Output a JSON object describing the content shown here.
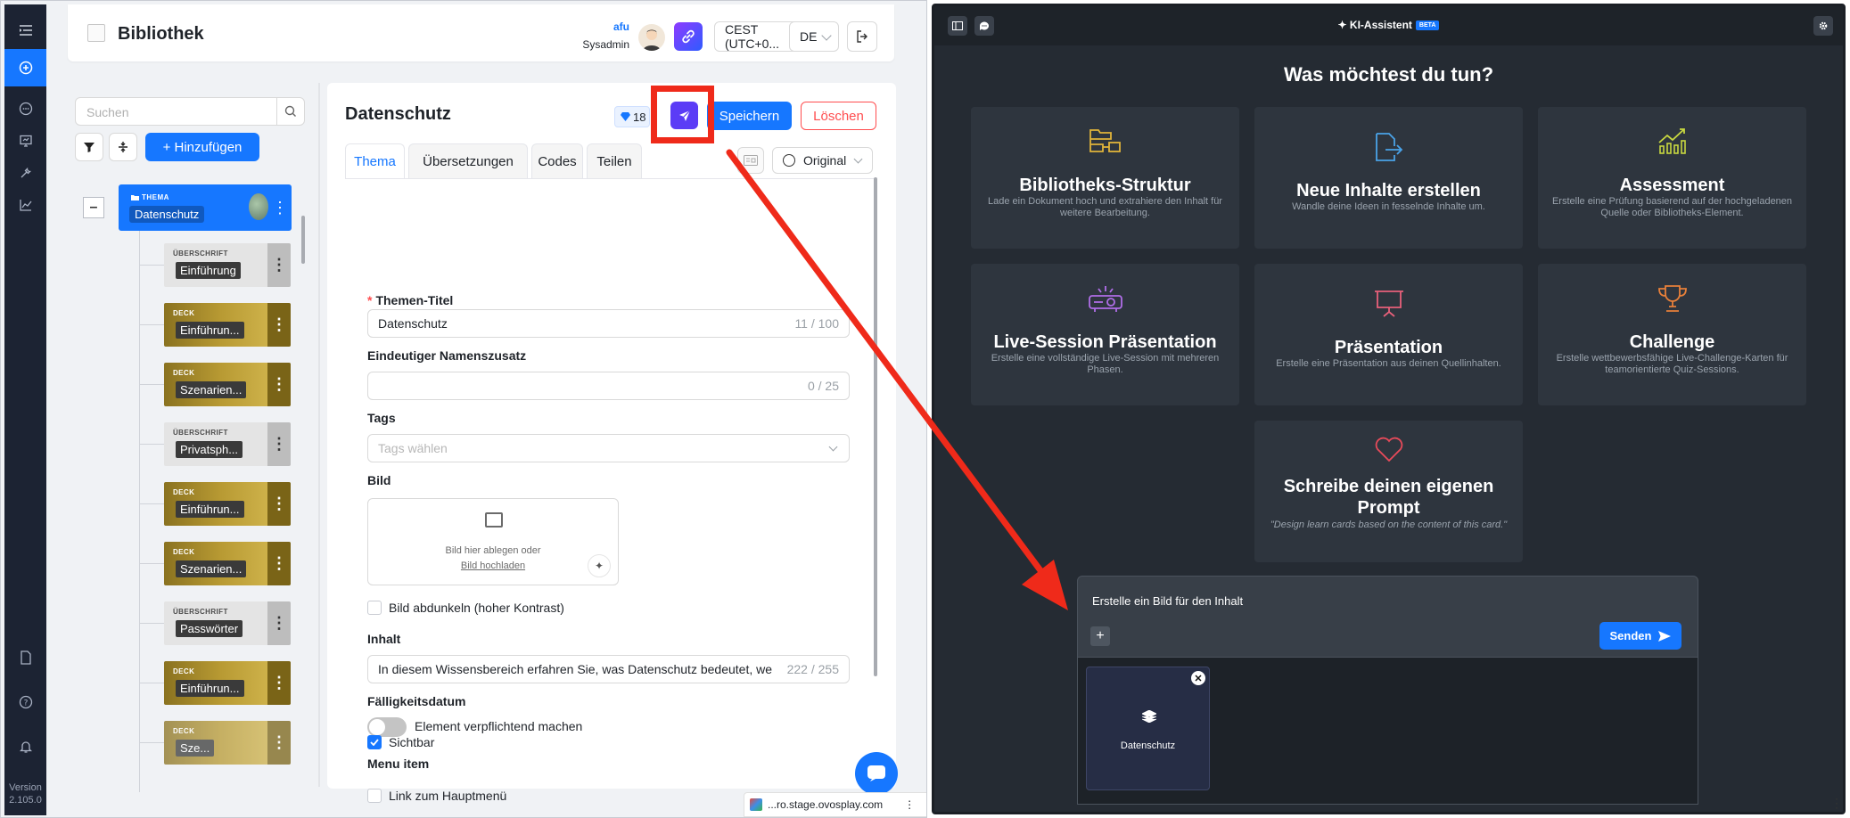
{
  "left_app": {
    "rail": {
      "items": [
        "menu",
        "add",
        "chat",
        "presentation",
        "tools",
        "chart"
      ],
      "bottom_items": [
        "document",
        "help",
        "notification"
      ],
      "version_label": "Version",
      "version_number": "2.105.0"
    },
    "topbar": {
      "title": "Bibliothek",
      "user_name": "afu",
      "user_role": "Sysadmin",
      "timezone": "CEST (UTC+0...",
      "language": "DE"
    },
    "tree": {
      "search_placeholder": "Suchen",
      "add_label": "+ Hinzufügen",
      "root": {
        "type": "THEMA",
        "name": "Datenschutz"
      },
      "children": [
        {
          "kind": "heading",
          "type": "ÜBERSCHRIFT",
          "name": "Einführung"
        },
        {
          "kind": "deck",
          "type": "DECK",
          "name": "Einführun..."
        },
        {
          "kind": "deck",
          "type": "DECK",
          "name": "Szenarien..."
        },
        {
          "kind": "heading",
          "type": "ÜBERSCHRIFT",
          "name": "Privatsph..."
        },
        {
          "kind": "deck",
          "type": "DECK",
          "name": "Einführun..."
        },
        {
          "kind": "deck",
          "type": "DECK",
          "name": "Szenarien..."
        },
        {
          "kind": "heading",
          "type": "ÜBERSCHRIFT",
          "name": "Passwörter"
        },
        {
          "kind": "deck",
          "type": "DECK",
          "name": "Einführun..."
        },
        {
          "kind": "deck",
          "type": "DECK",
          "name": "Sze..."
        }
      ]
    },
    "form": {
      "title": "Datenschutz",
      "badge_count": "18",
      "save_label": "Speichern",
      "delete_label": "Löschen",
      "tabs": [
        "Thema",
        "Übersetzungen",
        "Codes",
        "Teilen"
      ],
      "language_select": "Original",
      "fields": {
        "title_label": "Themen-Titel",
        "title_value": "Datenschutz",
        "title_count": "11 / 100",
        "suffix_label": "Eindeutiger Namenszusatz",
        "suffix_value": "",
        "suffix_count": "0 / 25",
        "tags_label": "Tags",
        "tags_placeholder": "Tags wählen",
        "image_label": "Bild",
        "image_drop_text": "Bild hier ablegen oder",
        "image_upload_link": "Bild hochladen",
        "darken_label": "Bild abdunkeln (hoher Kontrast)",
        "content_label": "Inhalt",
        "content_value": "In diesem Wissensbereich erfahren Sie, was Datenschutz bedeutet, we",
        "content_count": "222 / 255",
        "due_label": "Fälligkeitsdatum",
        "mandatory_label": "Element verpflichtend machen",
        "menu_item_label": "Menu item",
        "main_menu_link_label": "Link zum Hauptmenü",
        "visible_label": "Sichtbar"
      }
    },
    "url_bar": {
      "text": "...ro.stage.ovosplay.com"
    }
  },
  "ai_assistant": {
    "title": "KI-Assistent",
    "beta": "BETA",
    "question": "Was möchtest du tun?",
    "cards": [
      {
        "title": "Bibliotheks-Struktur",
        "desc": "Lade ein Dokument hoch und extrahiere den Inhalt für weitere Bearbeitung.",
        "icon": "structure-icon",
        "color": "#e0b43a"
      },
      {
        "title": "Neue Inhalte erstellen",
        "desc": "Wandle deine Ideen in fesselnde Inhalte um.",
        "icon": "new-content-icon",
        "color": "#4aa3e8"
      },
      {
        "title": "Assessment",
        "desc": "Erstelle eine Prüfung basierend auf der hochgeladenen Quelle oder Bibliotheks-Element.",
        "icon": "assessment-chart-icon",
        "color": "#c8d840"
      },
      {
        "title": "Live-Session Präsentation",
        "desc": "Erstelle eine vollständige Live-Session mit mehreren Phasen.",
        "icon": "projector-icon",
        "color": "#b06ee8"
      },
      {
        "title": "Präsentation",
        "desc": "Erstelle eine Präsentation aus deinen Quellinhalten.",
        "icon": "presentation-board-icon",
        "color": "#e8607a"
      },
      {
        "title": "Challenge",
        "desc": "Erstelle wettbewerbsfähige Live-Challenge-Karten für teamorientierte Quiz-Sessions.",
        "icon": "trophy-icon",
        "color": "#e8803a"
      },
      {
        "title": "Schreibe deinen eigenen Prompt",
        "desc": "\"Design learn cards based on the content of this card.\"",
        "icon": "heart-icon",
        "color": "#e84a5a"
      }
    ],
    "prompt_text": "Erstelle ein Bild für den Inhalt",
    "send_label": "Senden",
    "attachment_name": "Datenschutz"
  }
}
